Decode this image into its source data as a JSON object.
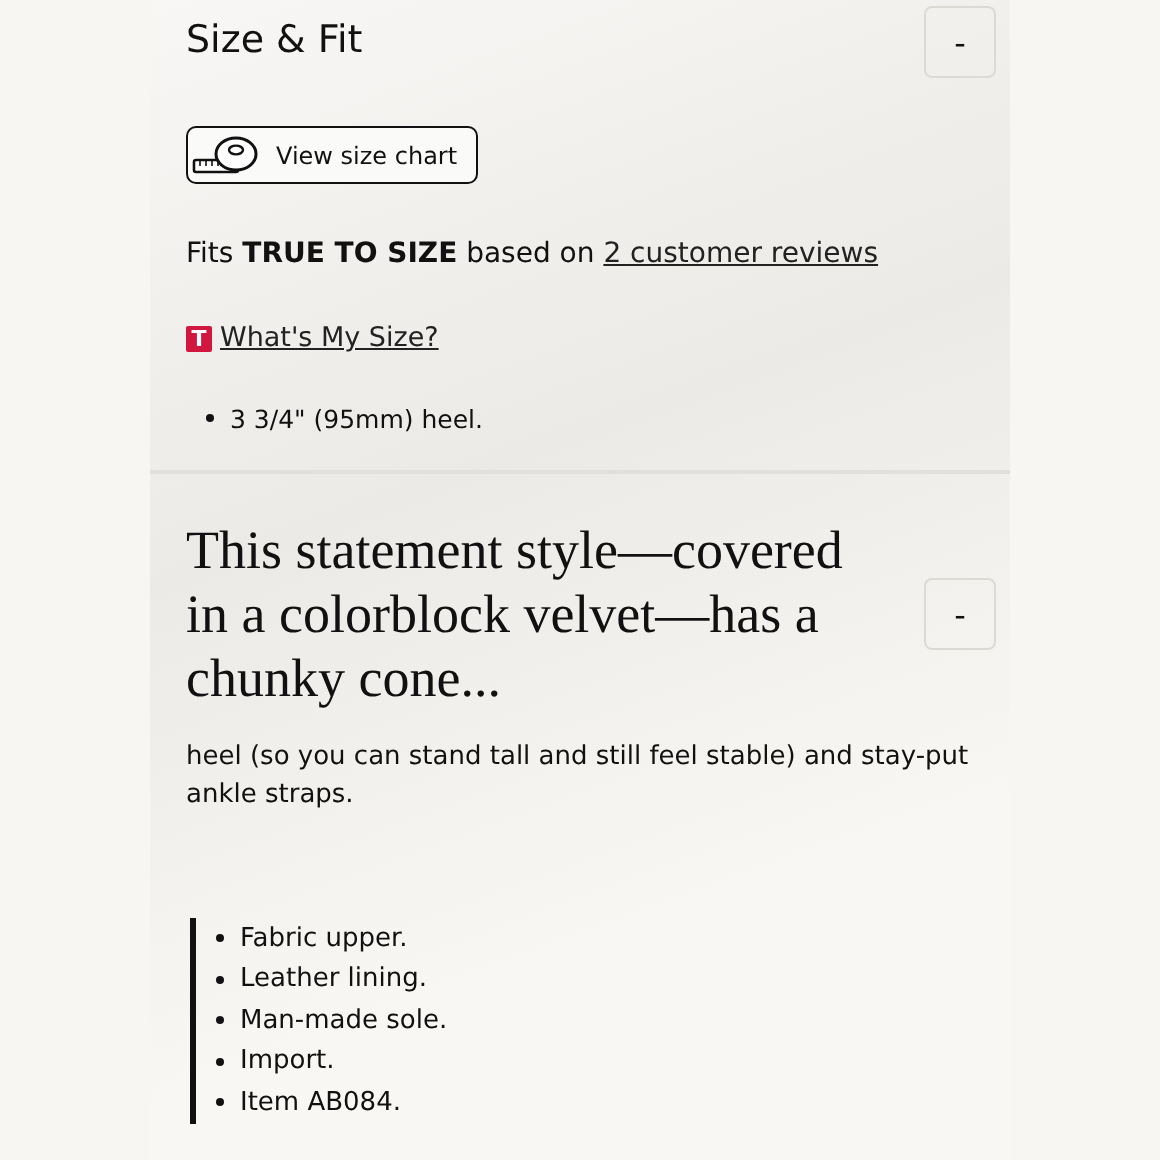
{
  "size_fit": {
    "title": "Size & Fit",
    "toggle": "-",
    "size_chart_button": "View size chart",
    "fit_text": "Fits **TRUE TO SIZE** based on ",
    "reviews_link": "2 customer reviews",
    "badge": "T",
    "whats_my_size": "What's My Size?",
    "bullets": [
      "3 3/4\" (95mm) heel."
    ]
  },
  "description": {
    "title": "This statement style—covered in a colorblock velvet—has a chunky cone...",
    "toggle": "-",
    "text": "heel (so you can stand tall and still feel stable) and stay-put ankle straps.",
    "bullets": [
      "Fabric upper.",
      "Leather lining.",
      "Man-made sole.",
      "Import.",
      "Item AB084."
    ]
  }
}
